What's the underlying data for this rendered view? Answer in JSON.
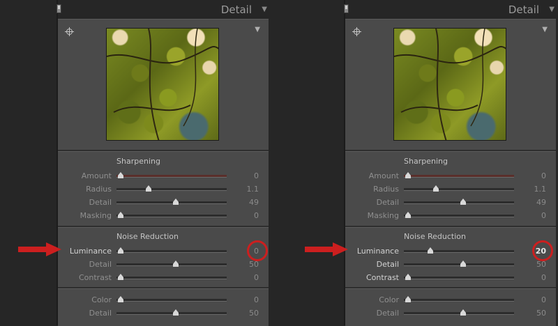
{
  "panels": [
    {
      "header_title": "Detail",
      "sharpening_title": "Sharpening",
      "sharpening": [
        {
          "label": "Amount",
          "value": "0",
          "fraction": 0.0
        },
        {
          "label": "Radius",
          "value": "1.1",
          "fraction": 0.25
        },
        {
          "label": "Detail",
          "value": "49",
          "fraction": 0.5
        },
        {
          "label": "Masking",
          "value": "0",
          "fraction": 0.0
        }
      ],
      "noise_title": "Noise Reduction",
      "luminance": {
        "label": "Luminance",
        "value": "0",
        "fraction": 0.0
      },
      "noise": [
        {
          "label": "Detail",
          "value": "50",
          "fraction": 0.5
        },
        {
          "label": "Contrast",
          "value": "0",
          "fraction": 0.0
        }
      ],
      "color_rows": [
        {
          "label": "Color",
          "value": "0",
          "fraction": 0.0
        },
        {
          "label": "Detail",
          "value": "50",
          "fraction": 0.5
        }
      ]
    },
    {
      "header_title": "Detail",
      "sharpening_title": "Sharpening",
      "sharpening": [
        {
          "label": "Amount",
          "value": "0",
          "fraction": 0.0
        },
        {
          "label": "Radius",
          "value": "1.1",
          "fraction": 0.25
        },
        {
          "label": "Detail",
          "value": "49",
          "fraction": 0.5
        },
        {
          "label": "Masking",
          "value": "0",
          "fraction": 0.0
        }
      ],
      "noise_title": "Noise Reduction",
      "luminance": {
        "label": "Luminance",
        "value": "20",
        "fraction": 0.2
      },
      "noise": [
        {
          "label": "Detail",
          "value": "50",
          "fraction": 0.5
        },
        {
          "label": "Contrast",
          "value": "0",
          "fraction": 0.0
        }
      ],
      "color_rows": [
        {
          "label": "Color",
          "value": "0",
          "fraction": 0.0
        },
        {
          "label": "Detail",
          "value": "50",
          "fraction": 0.5
        }
      ]
    }
  ],
  "colors": {
    "annotation_red": "#cc1f1f",
    "panel_bg": "#4a4a4a",
    "background": "#262626"
  },
  "icons": {
    "target": "crosshair-icon",
    "menu": "triangle-down-icon",
    "arrow": "red-arrow-icon"
  }
}
